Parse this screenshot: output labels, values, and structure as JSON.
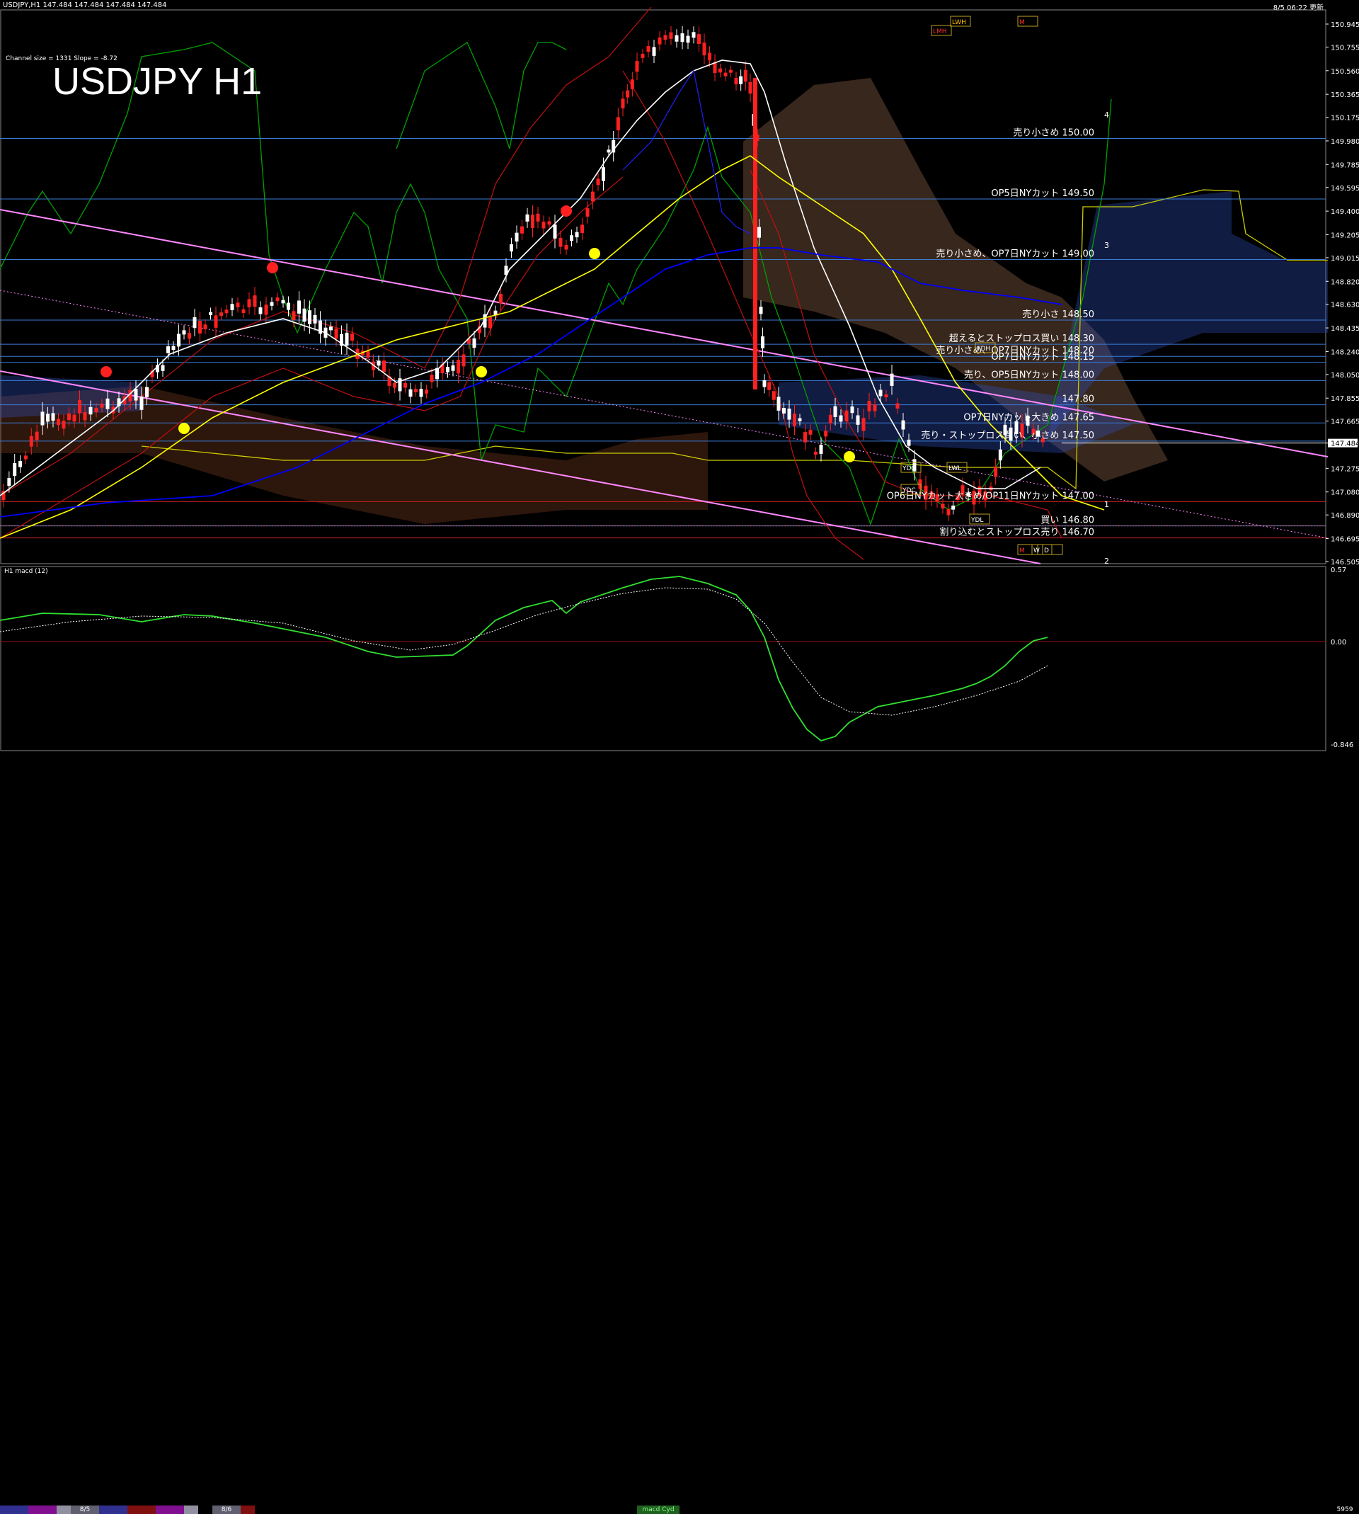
{
  "header": {
    "symbol_info": "USDJPY,H1  147.484 147.484 147.484 147.484",
    "time": "8/5 06:22 更新"
  },
  "chart_title": "USDJPY H1",
  "channel_info": "Channel size = 1331 Slope = -8.72",
  "macd_label": "H1  macd (12)",
  "chart_data": {
    "type": "line",
    "price_axis": [
      "150.945",
      "150.755",
      "150.560",
      "150.365",
      "150.175",
      "149.980",
      "149.785",
      "149.595",
      "149.400",
      "149.205",
      "149.015",
      "148.820",
      "148.630",
      "148.435",
      "148.240",
      "148.050",
      "147.855",
      "147.665",
      "147.484",
      "147.275",
      "147.080",
      "146.890",
      "146.695",
      "146.505"
    ],
    "macd_axis": [
      "0.57",
      "0.00",
      "-0.846"
    ],
    "current_price": "147.484",
    "levels": [
      {
        "label": "売り小さめ 150.00",
        "price": 150.0
      },
      {
        "label": "OP5日NYカット 149.50",
        "price": 149.5
      },
      {
        "label": "売り小さめ、OP7日NYカット 149.00",
        "price": 149.0
      },
      {
        "label": "売り小さ 148.50",
        "price": 148.5
      },
      {
        "label": "超えるとストップロス買い 148.30",
        "price": 148.3
      },
      {
        "label": "売り小さめ、OP7日NYカット 148.20",
        "price": 148.2
      },
      {
        "label": "OP7日NYカット 148.15",
        "price": 148.15
      },
      {
        "label": "売り、OP5日NYカット 148.00",
        "price": 148.0
      },
      {
        "label": "147.80",
        "price": 147.8
      },
      {
        "label": "OP7日NYカット大きめ 147.65",
        "price": 147.65
      },
      {
        "label": "売り・ストップロス買い、小さめ 147.50",
        "price": 147.5
      },
      {
        "label": "OP6日NYカット大きめ/OP11日NYカット 147.00",
        "price": 147.0
      },
      {
        "label": "買い 146.80",
        "price": 146.8
      },
      {
        "label": "割り込むとストップロス売り 146.70",
        "price": 146.7
      }
    ],
    "markers": [
      "YDH",
      "YDO",
      "YDC",
      "YDL",
      "LWH",
      "LWL",
      "LMH",
      "M",
      "W",
      "D"
    ],
    "wave_numbers": [
      "1",
      "2",
      "3",
      "4"
    ]
  },
  "bottom": {
    "tabs": [
      "8/5",
      "8/6"
    ],
    "macd_tab": "macd Cyd",
    "right_num": "5959"
  },
  "colors": {
    "background": "#000000",
    "level_line": "#3a7bd5",
    "ma_white": "#ffffff",
    "ma_yellow": "#ffff00",
    "ma_blue": "#0000ff",
    "trend_pink": "#ff88ff",
    "cloud_green": "#00aa00"
  }
}
